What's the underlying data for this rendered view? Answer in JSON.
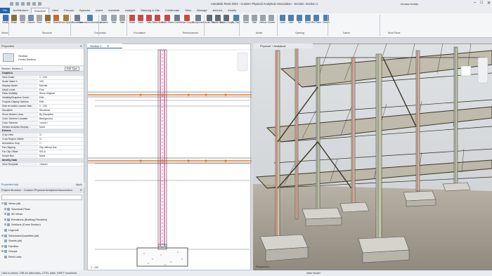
{
  "window": {
    "title": "Autodesk Revit 2024 - Custom Physical Analytical Association - Section: Section 1",
    "user": "tomasz.fudala",
    "minimize": "–",
    "maximize": "□",
    "close": "✕"
  },
  "tabs": [
    "File",
    "Architecture",
    "Structure",
    "Steel",
    "Precast",
    "Systems",
    "Insert",
    "Annotate",
    "Analyze",
    "Massing & Site",
    "Collaborate",
    "View",
    "Manage",
    "Add-Ins",
    "Modify"
  ],
  "active_tab": "Structure",
  "ribbon": {
    "buttons": [
      {
        "label": "Modify",
        "color": "#3b6fb6"
      },
      {
        "label": "Beam",
        "color": "#8a6d3b"
      },
      {
        "label": "Wall",
        "color": "#9aa3ad"
      },
      {
        "label": "Column",
        "color": "#7a8fa6"
      },
      {
        "label": "Floor",
        "color": "#a8a8a8"
      },
      {
        "label": "Truss",
        "color": "#8a6d3b"
      },
      {
        "label": "Brace",
        "color": "#c96b2b"
      },
      {
        "label": "Beam System",
        "color": "#a67c3a"
      },
      {
        "label": "Connection",
        "color": "#6a7d92"
      },
      {
        "label": "Connection Automation",
        "color": "#4f7fb0"
      },
      {
        "label": "Isolated",
        "color": "#9aa3ad"
      },
      {
        "label": "Wall",
        "color": "#9aa3ad"
      },
      {
        "label": "Slab",
        "color": "#a8a8a8"
      },
      {
        "label": "Rebar",
        "color": "#c94a4a"
      },
      {
        "label": "Area",
        "color": "#c94a4a"
      },
      {
        "label": "Path",
        "color": "#c94a4a"
      },
      {
        "label": "Fabric Area",
        "color": "#c94a4a"
      },
      {
        "label": "Fabric Sheet",
        "color": "#c94a4a"
      },
      {
        "label": "Cover",
        "color": "#6a7d92"
      },
      {
        "label": "Rebar Coupler",
        "color": "#c94a4a"
      },
      {
        "label": "Component",
        "color": "#6a7d92"
      },
      {
        "label": "Model Text",
        "color": "#5a6b7c"
      },
      {
        "label": "Model Line",
        "color": "#5a6b7c"
      },
      {
        "label": "Model Group",
        "color": "#5a6b7c"
      },
      {
        "label": "By Face",
        "color": "#4f7fb0"
      },
      {
        "label": "Shaft",
        "color": "#9aa3ad"
      },
      {
        "label": "Wall",
        "color": "#9aa3ad"
      },
      {
        "label": "Vertical",
        "color": "#9aa3ad"
      },
      {
        "label": "Dormer",
        "color": "#9aa3ad"
      },
      {
        "label": "Level",
        "color": "#4f7fb0"
      },
      {
        "label": "Grid",
        "color": "#4f7fb0"
      },
      {
        "label": "Set",
        "color": "#4f7fb0"
      },
      {
        "label": "Show",
        "color": "#4f7fb0"
      },
      {
        "label": "Ref Plane",
        "color": "#4f7fb0"
      },
      {
        "label": "Viewer",
        "color": "#4f7fb0"
      }
    ],
    "panels": [
      "Select",
      "Structure",
      "Connection",
      "Foundation",
      "Reinforcement",
      "Model",
      "Opening",
      "Datum",
      "Work Plane"
    ]
  },
  "properties": {
    "title": "Properties",
    "type_line1": "Section",
    "type_line2": "Cross Section",
    "selector_value": "Section: Section 1",
    "edit_type": "Edit Type",
    "rows": [
      {
        "k": "Graphics",
        "v": "",
        "section": true
      },
      {
        "k": "View Scale",
        "v": "1 : 100"
      },
      {
        "k": "Scale Value 1:",
        "v": "100"
      },
      {
        "k": "Display Model",
        "v": "Normal"
      },
      {
        "k": "Detail Level",
        "v": "Fine"
      },
      {
        "k": "Parts Visibility",
        "v": "Show Original"
      },
      {
        "k": "Visibility/Graphics Overri...",
        "v": "Edit..."
      },
      {
        "k": "Graphic Display Options",
        "v": "Edit..."
      },
      {
        "k": "Hide at scales coarser than",
        "v": "1 : 100"
      },
      {
        "k": "Discipline",
        "v": "Structural"
      },
      {
        "k": "Show Hidden Lines",
        "v": "By Discipline"
      },
      {
        "k": "Color Scheme Location",
        "v": "Background"
      },
      {
        "k": "Color Scheme",
        "v": "<none>"
      },
      {
        "k": "Default Analysis Display ...",
        "v": "None"
      },
      {
        "k": "Extents",
        "v": "",
        "section": true
      },
      {
        "k": "Crop View",
        "v": "☑"
      },
      {
        "k": "Crop Region Visible",
        "v": "☑"
      },
      {
        "k": "Annotation Crop",
        "v": "☐"
      },
      {
        "k": "Far Clipping",
        "v": "Clip without line"
      },
      {
        "k": "Far Clip Offset",
        "v": "931.6"
      },
      {
        "k": "Scope Box",
        "v": "None"
      },
      {
        "k": "Identity Data",
        "v": "",
        "section": true
      },
      {
        "k": "View Template",
        "v": "<None>"
      }
    ],
    "help_link": "Properties help",
    "apply": "Apply"
  },
  "browser": {
    "title": "Project Browser - Custom Physical Analytical Association",
    "items": [
      {
        "label": "Views (all)",
        "twisty": "⊟",
        "indent": 2
      },
      {
        "label": "Structural Plans",
        "twisty": "⊞",
        "indent": 6
      },
      {
        "label": "3D Views",
        "twisty": "⊞",
        "indent": 6
      },
      {
        "label": "Elevations (Building Elevation)",
        "twisty": "⊞",
        "indent": 6
      },
      {
        "label": "Sections (Cross Section)",
        "twisty": "⊞",
        "indent": 6
      },
      {
        "label": "Legends",
        "twisty": "",
        "indent": 2
      },
      {
        "label": "Schedules/Quantities (all)",
        "twisty": "⊞",
        "indent": 2
      },
      {
        "label": "Sheets (all)",
        "twisty": "",
        "indent": 2
      },
      {
        "label": "Families",
        "twisty": "⊞",
        "indent": 2
      },
      {
        "label": "Groups",
        "twisty": "⊞",
        "indent": 2
      },
      {
        "label": "Revit Links",
        "twisty": "",
        "indent": 2
      }
    ]
  },
  "views": {
    "section_tab": "Section 1",
    "persp_tab": "Physical + Analytical",
    "section_scale": "1 : 100",
    "persp_label": "Perspective"
  },
  "status": {
    "hint": "Click to select, TAB for alternates, CTRL adds, SHIFT unselects.",
    "model": "Main Model"
  }
}
